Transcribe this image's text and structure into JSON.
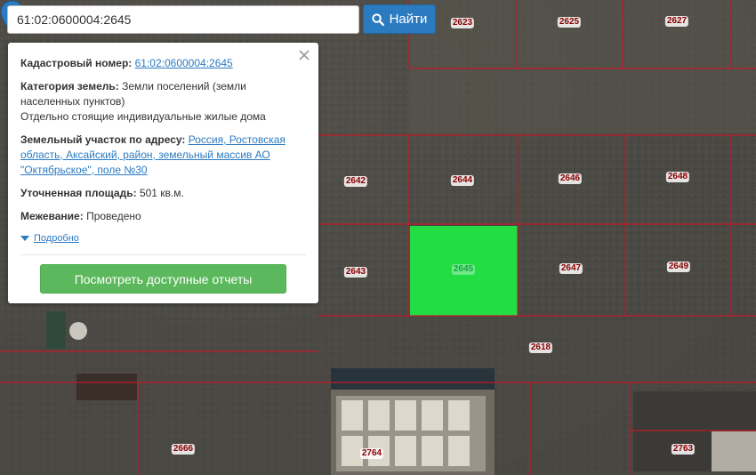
{
  "search": {
    "value": "61:02:0600004:2645",
    "button_label": "Найти"
  },
  "popup": {
    "cadastral_label": "Кадастровый номер:",
    "cadastral_value": "61:02:0600004:2645",
    "category_label": "Категория земель:",
    "category_value_line1": "Земли поселений (земли",
    "category_value_line2": "населенных пунктов)",
    "category_use": "Отдельно стоящие индивидуальные жилые дома",
    "address_label": "Земельный участок по адресу:",
    "address_value_inline": "Россия, Ростовская",
    "address_value_line2": "область, Аксайский, район, земельный массив АО",
    "address_value_line3": "\"Октябрьское\", поле №30",
    "area_label": "Уточненная площадь:",
    "area_value": "501 кв.м.",
    "survey_label": "Межевание:",
    "survey_value": "Проведено",
    "more_link": "Подробно",
    "reports_button": "Посмотреть доступные отчеты"
  },
  "map": {
    "parcels": [
      "2623",
      "2625",
      "2627",
      "2642",
      "2644",
      "2646",
      "2648",
      "2643",
      "2645",
      "2647",
      "2649",
      "2618",
      "2666",
      "2764",
      "2763"
    ],
    "selected_parcel": "2645",
    "colors": {
      "selected_fill": "#22dd44",
      "boundary": "#c0192a",
      "button_blue": "#2b7bc1",
      "button_green": "#5cb85c",
      "pin": "#2b7bc1"
    }
  },
  "icons": {
    "search_button": "search-icon",
    "close": "close-icon",
    "marker": "map-marker-icon",
    "expand": "triangle-down-icon"
  }
}
